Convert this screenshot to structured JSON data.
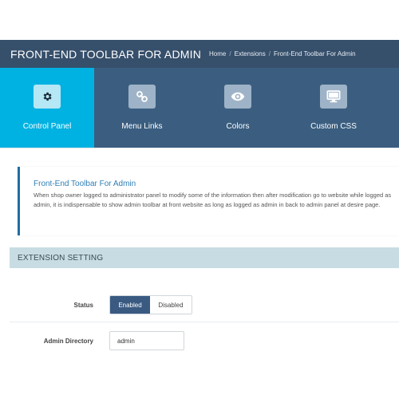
{
  "header": {
    "title": "FRONT-END TOOLBAR FOR ADMIN",
    "breadcrumb": [
      "Home",
      "Extensions",
      "Front-End Toolbar For Admin"
    ]
  },
  "tabs": [
    {
      "label": "Control Panel",
      "icon": "gear-icon",
      "active": true
    },
    {
      "label": "Menu Links",
      "icon": "link-icon",
      "active": false
    },
    {
      "label": "Colors",
      "icon": "eye-icon",
      "active": false
    },
    {
      "label": "Custom CSS",
      "icon": "monitor-icon",
      "active": false
    }
  ],
  "info": {
    "title": "Front-End Toolbar For Admin",
    "text": "When shop owner logged to administrator panel to modify some of the information then after modification go to website while logged as admin, it is indispensable to show admin toolbar at front website as long as logged as admin in back to admin panel at desire page."
  },
  "settings": {
    "section_title": "EXTENSION SETTING",
    "status_label": "Status",
    "status_on": "Enabled",
    "status_off": "Disabled",
    "admin_dir_label": "Admin Directory",
    "admin_dir_value": "admin"
  },
  "colors": {
    "header_bg": "#364f6b",
    "tab_bar_bg": "#3b5e80",
    "active_tab_bg": "#00b2e2",
    "section_bg": "#c7dde3",
    "enabled_bg": "#3a5a82"
  }
}
